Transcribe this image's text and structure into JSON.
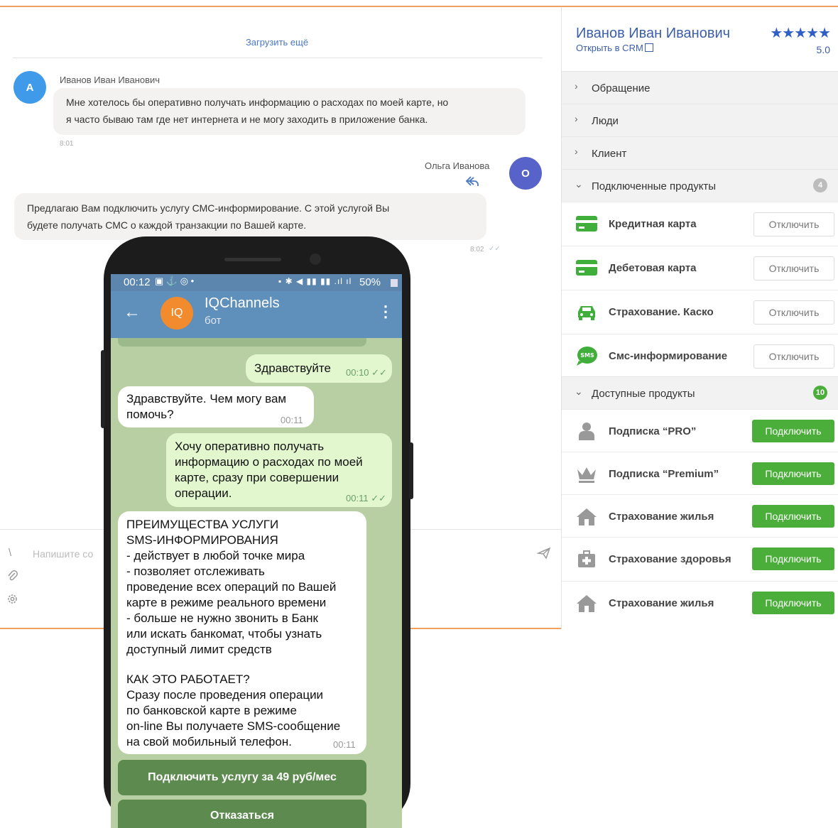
{
  "chat": {
    "load_more": "Загрузить ещё",
    "msg1": {
      "avatar_letter": "А",
      "author": "Иванов Иван Иванович",
      "line1": "Мне хотелось бы оперативно получать информацию о расходах по моей карте, но",
      "line2": "я часто бываю там где нет интернета и не могу заходить в приложение банка.",
      "time": "8:01"
    },
    "msg2": {
      "avatar_letter": "О",
      "author": "Ольга Иванова",
      "line1": "Предлагаю Вам подключить услугу СМС-информирование. С этой услугой Вы",
      "line2": "будете получать СМС о каждой транзакции по Вашей карте.",
      "time": "8:02"
    },
    "input_placeholder": "Напишите со"
  },
  "panel": {
    "client_name": "Иванов Иван Иванович",
    "crm_link": "Открыть в CRM",
    "rating": "5.0",
    "stars": "★★★★★",
    "sections": {
      "request": "Обращение",
      "people": "Люди",
      "client": "Клиент",
      "connected": "Подключенные продукты",
      "connected_count": "4",
      "available": "Доступные продукты",
      "available_count": "10"
    },
    "connected_products": [
      {
        "label": "Кредитная карта",
        "button": "Отключить"
      },
      {
        "label": "Дебетовая карта",
        "button": "Отключить"
      },
      {
        "label": "Страхование. Каско",
        "button": "Отключить"
      },
      {
        "label": "Смс-информирование",
        "button": "Отключить"
      }
    ],
    "available_products": [
      {
        "label": "Подписка “PRO”",
        "button": "Подключить"
      },
      {
        "label": "Подписка “Premium”",
        "button": "Подключить"
      },
      {
        "label": "Страхование жилья",
        "button": "Подключить"
      },
      {
        "label": "Страхование здоровья",
        "button": "Подключить"
      },
      {
        "label": "Страхование жилья",
        "button": "Подключить"
      }
    ],
    "sms_icon_text": "SMS"
  },
  "phone": {
    "status_time": "00:12",
    "status_right": "50%",
    "bot_avatar": "IQ",
    "bot_name": "IQChannels",
    "bot_sub": "бот",
    "m1": {
      "text": "Здравствуйте",
      "time": "00:10"
    },
    "m2": {
      "text": "Здравствуйте. Чем могу вам помочь?",
      "time": "00:11"
    },
    "m3": {
      "text": "Хочу оперативно получать информацию о расходах по моей карте, сразу при совершении операции.",
      "time": "00:11"
    },
    "m4": {
      "lines": [
        "ПРЕИМУЩЕСТВА УСЛУГИ",
        "SMS-ИНФОРМИРОВАНИЯ",
        "- действует в любой точке мира",
        "- позволяет отслеживать",
        "проведение всех операций по Вашей",
        "карте в режиме реального времени",
        "- больше не нужно звонить в Банк",
        "или искать банкомат, чтобы узнать",
        "доступный лимит средств",
        "",
        "КАК ЭТО РАБОТАЕТ?",
        "Сразу после проведения операции",
        "по банковской карте в режиме",
        "on-line Вы получаете SMS-сообщение",
        "на свой мобильный телефон."
      ],
      "time": "00:11"
    },
    "btn_connect": "Подключить услугу за 49 руб/мес",
    "btn_refuse": "Отказаться"
  }
}
